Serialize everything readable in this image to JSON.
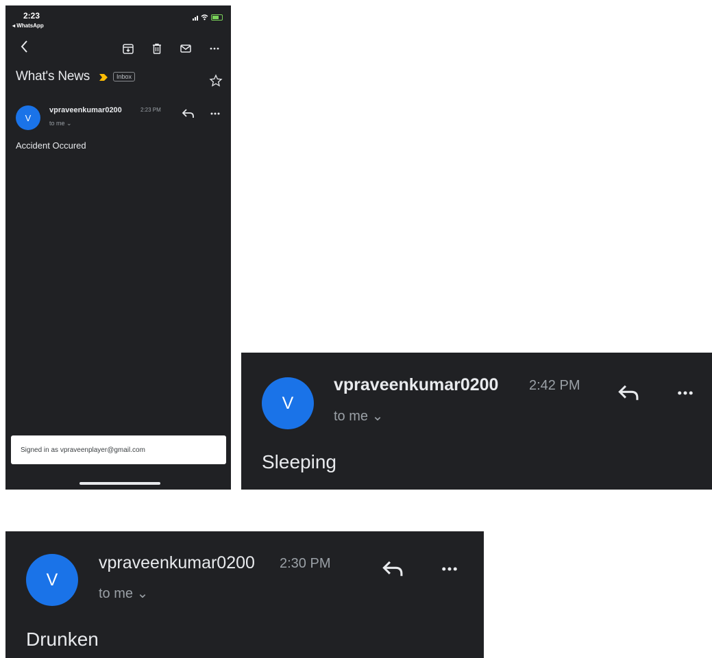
{
  "phone": {
    "status": {
      "time": "2:23",
      "back_app": "◂ WhatsApp"
    },
    "subject": "What's News",
    "label_chip": "Inbox",
    "message": {
      "avatar_letter": "V",
      "sender": "vpraveenkumar0200",
      "time": "2:23 PM",
      "recipient": "to me ⌄",
      "body": "Accident Occured"
    },
    "signed_in_text": "Signed in as vpraveenplayer@gmail.com",
    "icons": [
      "back-arrow-icon",
      "archive-icon",
      "trash-icon",
      "mail-icon",
      "more-icon",
      "importance-marker-icon",
      "star-icon",
      "reply-icon"
    ]
  },
  "cards": [
    {
      "avatar_letter": "V",
      "sender": "vpraveenkumar0200",
      "time": "2:42 PM",
      "recipient": "to me ⌄",
      "body": "Sleeping"
    },
    {
      "avatar_letter": "V",
      "sender": "vpraveenkumar0200",
      "time": "2:30 PM",
      "recipient": "to me ⌄",
      "body": "Drunken"
    }
  ],
  "colors": {
    "background": "#202124",
    "avatar": "#1a73e8",
    "importance": "#fbbc04",
    "text_primary": "#e8eaed",
    "text_secondary": "#9aa0a6"
  }
}
